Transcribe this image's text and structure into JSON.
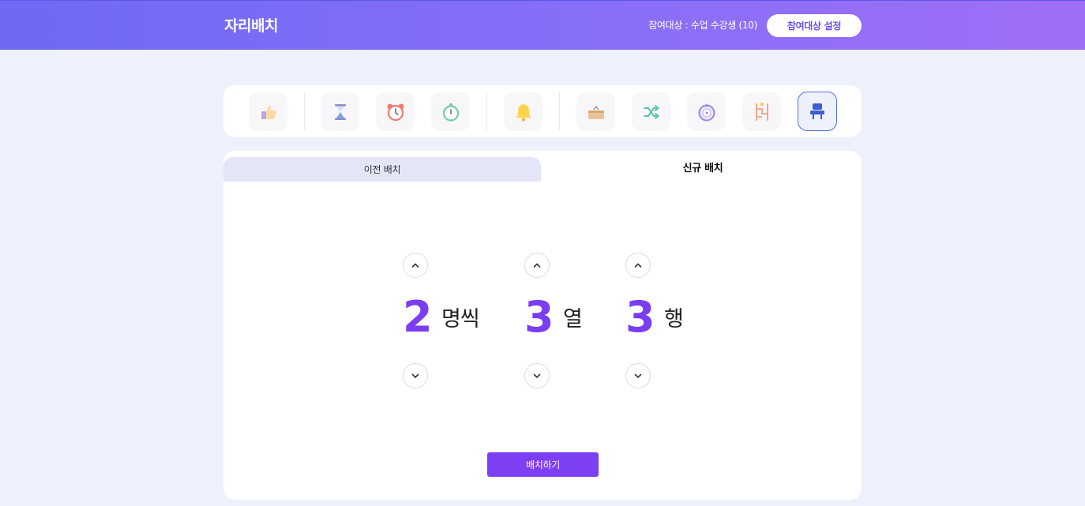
{
  "header": {
    "title": "자리배치",
    "participants": "참여대상 : 수업 수강생 (10)",
    "setting_button": "참여대상 설정"
  },
  "toolbar": {
    "tools": [
      {
        "name": "thumbs-up-icon",
        "active": false
      },
      {
        "name": "hourglass-icon",
        "active": false
      },
      {
        "name": "alarm-clock-icon",
        "active": false
      },
      {
        "name": "stopwatch-icon",
        "active": false
      },
      {
        "name": "bell-icon",
        "active": false
      },
      {
        "name": "draw-box-icon",
        "active": false
      },
      {
        "name": "shuffle-icon",
        "active": false
      },
      {
        "name": "roulette-icon",
        "active": false
      },
      {
        "name": "ladder-icon",
        "active": false
      },
      {
        "name": "seat-icon",
        "active": true
      }
    ]
  },
  "tabs": {
    "previous": "이전 배치",
    "new": "신규 배치"
  },
  "settings": {
    "per_seat": {
      "value": "2",
      "unit": "명씩"
    },
    "columns": {
      "value": "3",
      "unit": "열"
    },
    "rows": {
      "value": "3",
      "unit": "행"
    }
  },
  "arrange_button": "배치하기",
  "colors": {
    "accent": "#7a3df0",
    "header_start": "#6d6af5",
    "header_end": "#9f6ef6",
    "background": "#eef0fb",
    "active_tool_border": "#4f6fe0"
  }
}
